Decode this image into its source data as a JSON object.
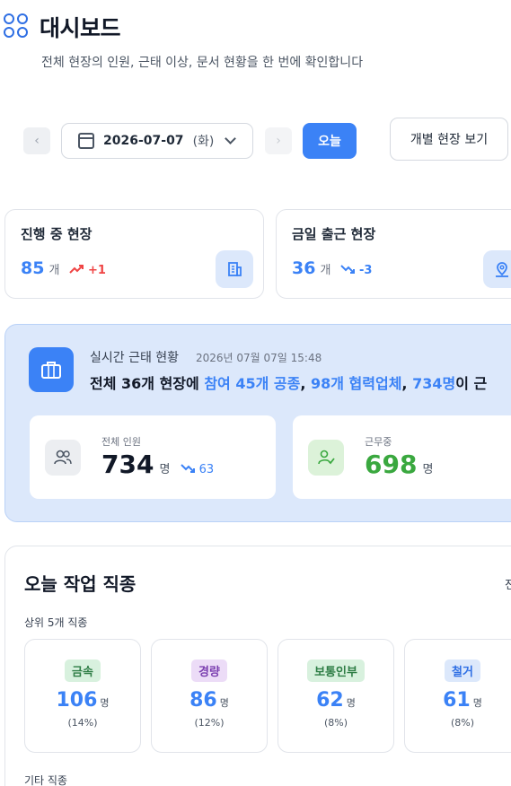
{
  "header": {
    "title": "대시보드",
    "subtitle": "전체 현장의 인원, 근태 이상, 문서 현황을 한 번에 확인합니다"
  },
  "toolbar": {
    "date": "2026-07-07",
    "day": "(화)",
    "today_label": "오늘",
    "site_view_label": "개별 현장 보기"
  },
  "stats": [
    {
      "label": "진행 중 현장",
      "value": "85",
      "unit": "개",
      "trend": "+1",
      "trend_dir": "up",
      "icon": "building-icon"
    },
    {
      "label": "금일 출근 현장",
      "value": "36",
      "unit": "개",
      "trend": "-3",
      "trend_dir": "down",
      "icon": "map-pin-icon"
    }
  ],
  "realtime": {
    "title": "실시간 근태 현황",
    "timestamp": "2026년 07월 07일 15:48",
    "summary_parts": [
      "전체 36개 현장",
      "에 ",
      "참여 45개 공종",
      ", ",
      "98개 협력업체",
      ", ",
      "734명",
      "이 근"
    ],
    "cards": [
      {
        "label": "전체 인원",
        "value": "734",
        "unit": "명",
        "trend": "63"
      },
      {
        "label": "근무중",
        "value": "698",
        "unit": "명",
        "trend": ""
      }
    ]
  },
  "worktype": {
    "title": "오늘 작업 직종",
    "cut_label": "전",
    "top_label": "상위 5개 직종",
    "trades": [
      {
        "name": "금속",
        "count": "106",
        "unit": "명",
        "pct": "(14%)",
        "badge_bg": "#d8f1de",
        "badge_fg": "#2e7d45"
      },
      {
        "name": "경량",
        "count": "86",
        "unit": "명",
        "pct": "(12%)",
        "badge_bg": "#ecdcf7",
        "badge_fg": "#7b3fb0"
      },
      {
        "name": "보통인부",
        "count": "62",
        "unit": "명",
        "pct": "(8%)",
        "badge_bg": "#d8f1de",
        "badge_fg": "#2e7d45"
      },
      {
        "name": "철거",
        "count": "61",
        "unit": "명",
        "pct": "(8%)",
        "badge_bg": "#dce8fb",
        "badge_fg": "#2f6fe4"
      }
    ],
    "other_label": "기타 직종"
  }
}
